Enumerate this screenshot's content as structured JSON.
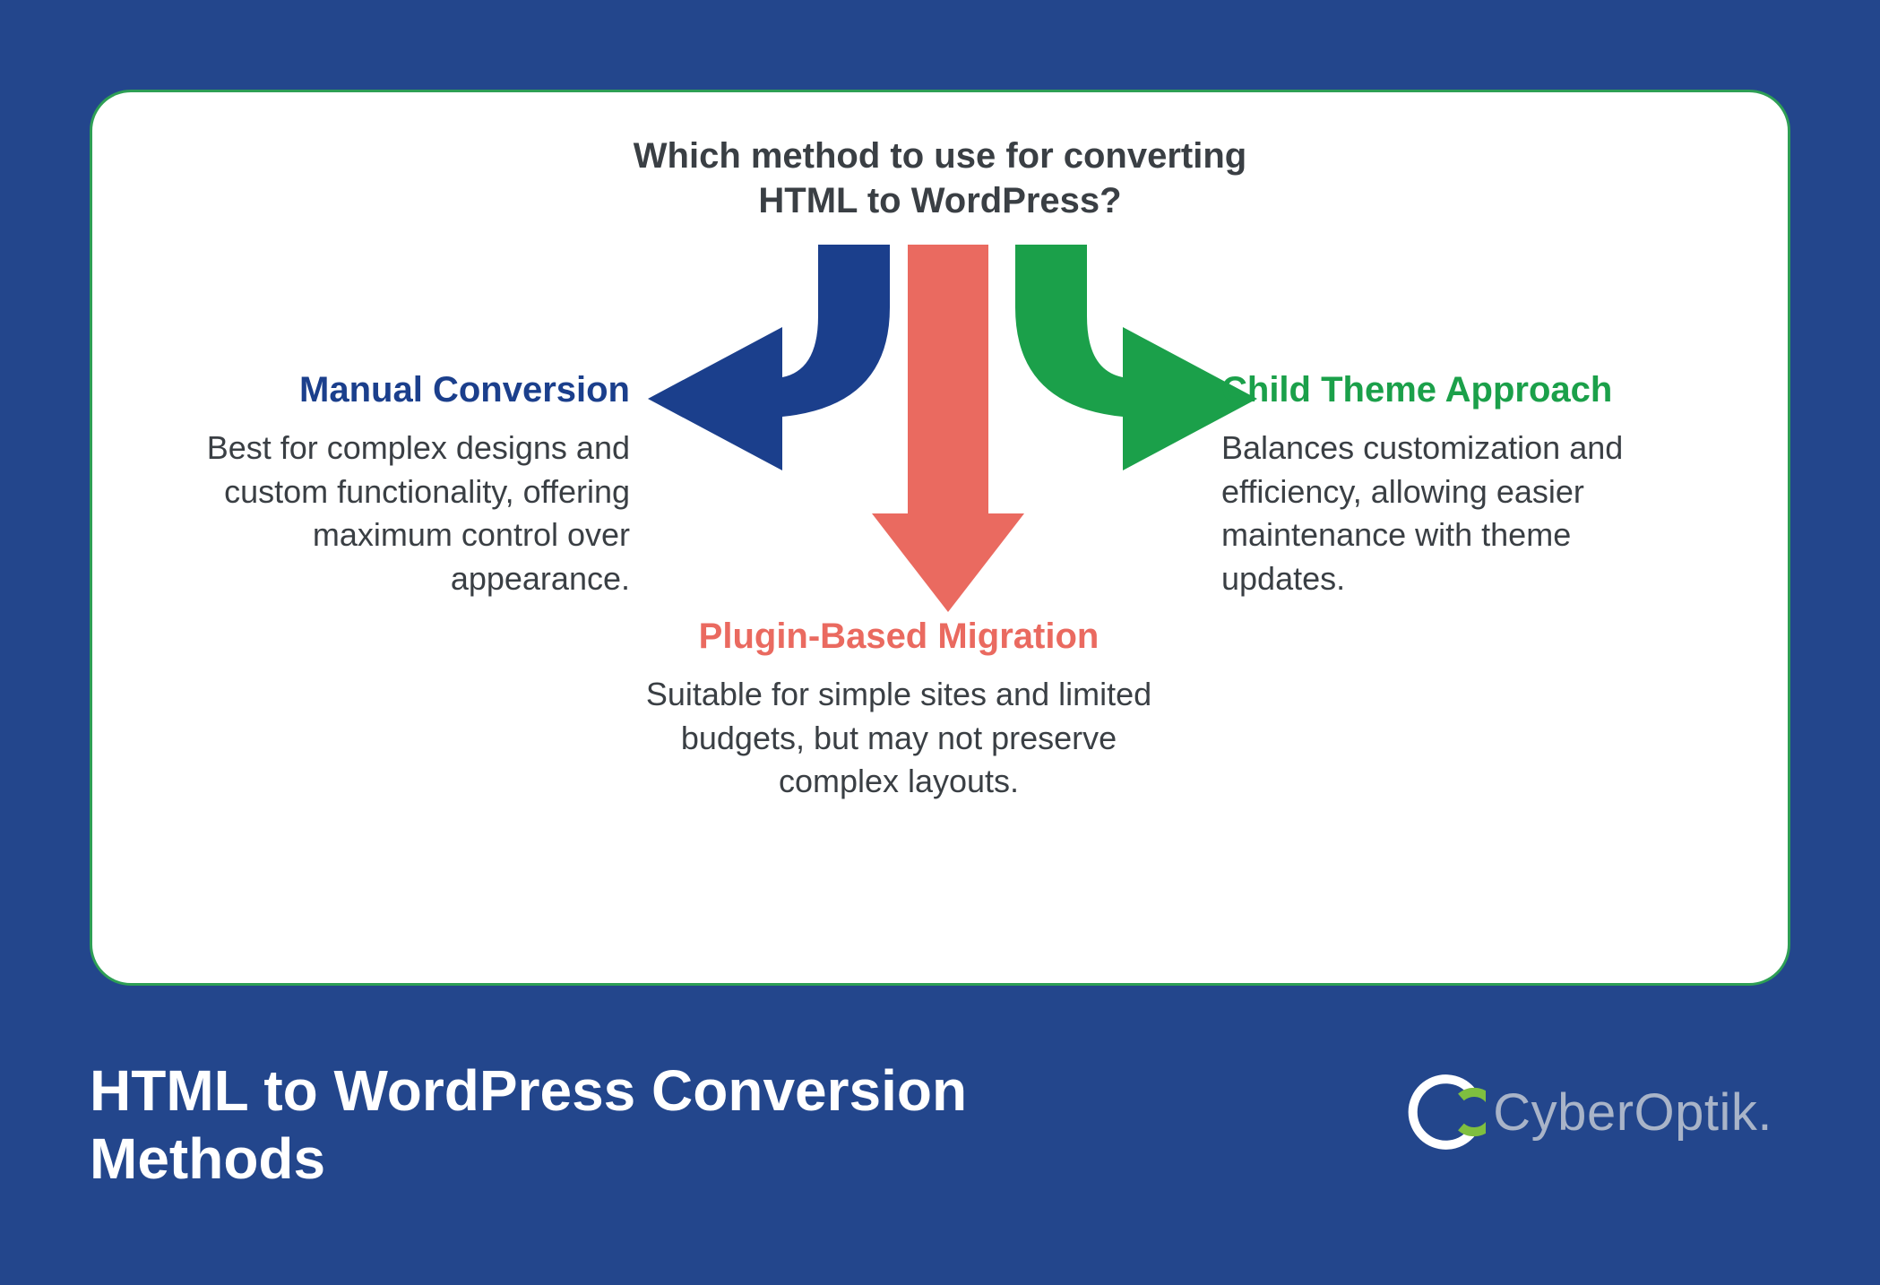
{
  "colors": {
    "bg": "#23468c",
    "cardBorder": "#2e9f55",
    "blue": "#1b3f8c",
    "red": "#ea6a60",
    "green": "#1ba04a"
  },
  "card": {
    "question_line1": "Which method to use for converting",
    "question_line2": "HTML to WordPress?"
  },
  "branches": {
    "left": {
      "title": "Manual Conversion",
      "desc": "Best for complex designs and custom functionality, offering maximum control over appearance."
    },
    "middle": {
      "title": "Plugin-Based Migration",
      "desc": "Suitable for simple sites and limited budgets, but may not preserve complex layouts."
    },
    "right": {
      "title": "Child Theme Approach",
      "desc": "Balances customization and efficiency, allowing easier maintenance with theme updates."
    }
  },
  "footer": {
    "title": "HTML to WordPress Conversion Methods"
  },
  "brand": {
    "name": "CyberOptik.",
    "icon": "cyberoptik-logo-icon"
  }
}
